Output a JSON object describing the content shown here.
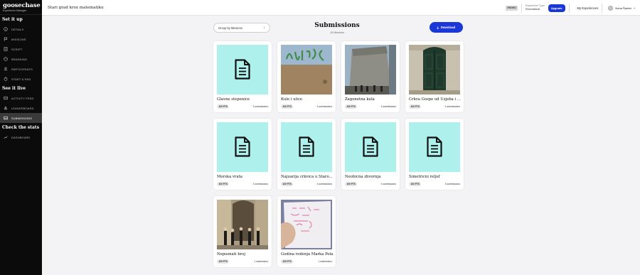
{
  "app": {
    "brand": "goosechase",
    "brand_sub": "Experience Manager"
  },
  "sidebar": {
    "sections": [
      {
        "title": "Set it up",
        "items": [
          {
            "label": "DETAILS",
            "icon": "info-icon"
          },
          {
            "label": "MISSIONS",
            "icon": "flag-icon"
          },
          {
            "label": "SCRIPT",
            "icon": "script-icon"
          },
          {
            "label": "BRANDING",
            "icon": "palette-icon"
          },
          {
            "label": "PARTICIPANTS",
            "icon": "participants-icon"
          },
          {
            "label": "START & END",
            "icon": "clock-icon"
          }
        ]
      },
      {
        "title": "See it live",
        "items": [
          {
            "label": "ACTIVITY FEED",
            "icon": "feed-icon"
          },
          {
            "label": "LEADERBOARD",
            "icon": "leaderboard-icon"
          },
          {
            "label": "SUBMISSIONS",
            "icon": "photo-icon",
            "active": true
          }
        ]
      },
      {
        "title": "Check the stats",
        "items": [
          {
            "label": "DASHBOARD",
            "icon": "trend-icon"
          }
        ]
      }
    ]
  },
  "topbar": {
    "experience_title": "Stari grad kroz matematiku",
    "status_badge": "ENDED",
    "experience_type_label": "Experience Type",
    "experience_type_value": "Recreational",
    "upgrade_label": "Upgrade",
    "my_experiences_label": "My Experiences",
    "user_name": "Nona Šarinić"
  },
  "main": {
    "group_by_label": "Group by Missions",
    "title": "Submissions",
    "subtitle": "10 Missions",
    "download_label": "Download"
  },
  "colors": {
    "accent": "#1a37d8",
    "placeholder_bg": "#aef0ec",
    "sidebar_bg": "#0b0b0b"
  },
  "cards": [
    {
      "title": "Glavne stepenice",
      "points": "100 PTS",
      "submissions": "3 submissions",
      "thumb": "doc"
    },
    {
      "title": "Kule i ulice",
      "points": "100 PTS",
      "submissions": "3 submissions",
      "thumb": "photo-wall"
    },
    {
      "title": "Zagonetna kula",
      "points": "100 PTS",
      "submissions": "3 submissions",
      "thumb": "photo-tower"
    },
    {
      "title": "Crkva Gospe od Uzjeba i ...",
      "points": "100 PTS",
      "submissions": "3 submissions",
      "thumb": "photo-door"
    },
    {
      "title": "Morska vrata",
      "points": "100 PTS",
      "submissions": "3 submissions",
      "thumb": "doc"
    },
    {
      "title": "Najuarija crkvica u Staro...",
      "points": "100 PTS",
      "submissions": "3 submissions",
      "thumb": "doc"
    },
    {
      "title": "Neobicna zbvornja",
      "points": "100 PTS",
      "submissions": "3 submissions",
      "thumb": "doc"
    },
    {
      "title": "Simetricni reljef",
      "points": "100 PTS",
      "submissions": "3 submissions",
      "thumb": "doc"
    },
    {
      "title": "Nepoznati broj",
      "points": "100 PTS",
      "submissions": "1 submission",
      "thumb": "photo-people"
    },
    {
      "title": "Godina rodenja Marka Pola",
      "points": "100 PTS",
      "submissions": "1 submission",
      "thumb": "photo-paper"
    }
  ]
}
